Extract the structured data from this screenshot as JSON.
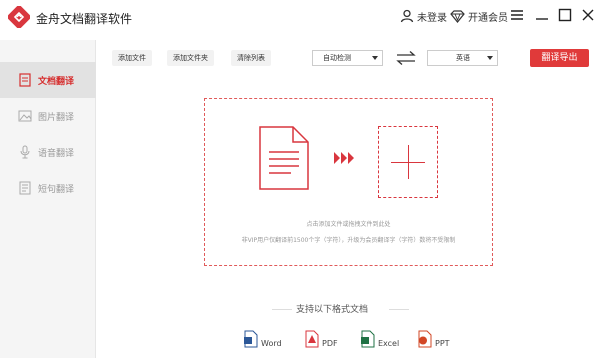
{
  "app": {
    "title": "金舟文档翻译软件"
  },
  "header": {
    "login_label": "未登录",
    "vip_label": "开通会员"
  },
  "sidebar": {
    "items": [
      {
        "label": "文档翻译",
        "icon": "document-icon",
        "active": true
      },
      {
        "label": "图片翻译",
        "icon": "image-icon",
        "active": false
      },
      {
        "label": "语音翻译",
        "icon": "microphone-icon",
        "active": false
      },
      {
        "label": "短句翻译",
        "icon": "text-note-icon",
        "active": false
      }
    ]
  },
  "toolbar": {
    "add_file": "添加文件",
    "add_folder": "添加文件夹",
    "clear_list": "清除列表",
    "source_lang": "自动检测",
    "target_lang": "英语",
    "export": "翻译导出"
  },
  "dropzone": {
    "hint": "点击添加文件或拖拽文件到此处",
    "limit": "非VIP用户仅翻译前1500个字（字符），升级为会员翻译字（字符）数将不受限制"
  },
  "formats": {
    "title": "支持以下格式文档",
    "items": [
      {
        "label": "Word",
        "color": "#2b5797"
      },
      {
        "label": "PDF",
        "color": "#d9363e"
      },
      {
        "label": "Excel",
        "color": "#1f7244"
      },
      {
        "label": "PPT",
        "color": "#d24726"
      }
    ]
  },
  "colors": {
    "accent": "#e03a3a"
  }
}
